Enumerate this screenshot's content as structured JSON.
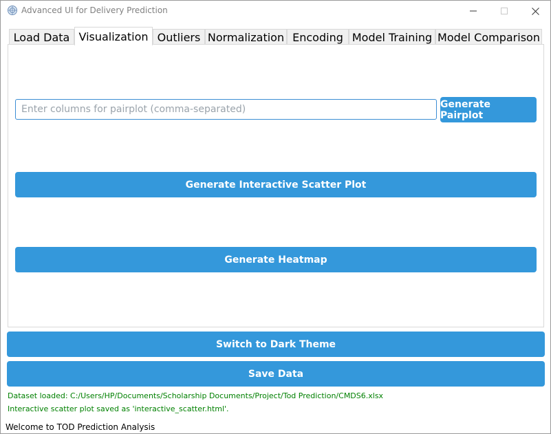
{
  "window": {
    "title": "Advanced UI for Delivery Prediction",
    "controls": [
      "minimize-icon",
      "maximize-icon",
      "close-icon"
    ]
  },
  "tabs": [
    {
      "label": "Load Data",
      "active": false
    },
    {
      "label": "Visualization",
      "active": true
    },
    {
      "label": "Outliers",
      "active": false
    },
    {
      "label": "Normalization",
      "active": false
    },
    {
      "label": "Encoding",
      "active": false
    },
    {
      "label": "Model Training",
      "active": false
    },
    {
      "label": "Model Comparison",
      "active": false
    }
  ],
  "visualization": {
    "pairplot_placeholder": "Enter columns for pairplot (comma-separated)",
    "pairplot_value": "",
    "generate_pairplot_label": "Generate Pairplot",
    "scatter_label": "Generate Interactive Scatter Plot",
    "heatmap_label": "Generate Heatmap"
  },
  "footer": {
    "theme_label": "Switch to Dark Theme",
    "save_label": "Save Data",
    "status_lines": [
      "Dataset loaded: C:/Users/HP/Documents/Scholarship Documents/Project/Tod Prediction/CMDS6.xlsx",
      "Interactive scatter plot saved as 'interactive_scatter.html'."
    ],
    "welcome": "Welcome to TOD Prediction Analysis"
  },
  "colors": {
    "accent": "#3498db",
    "status_text": "#008000",
    "input_border": "#3a8dd4"
  }
}
